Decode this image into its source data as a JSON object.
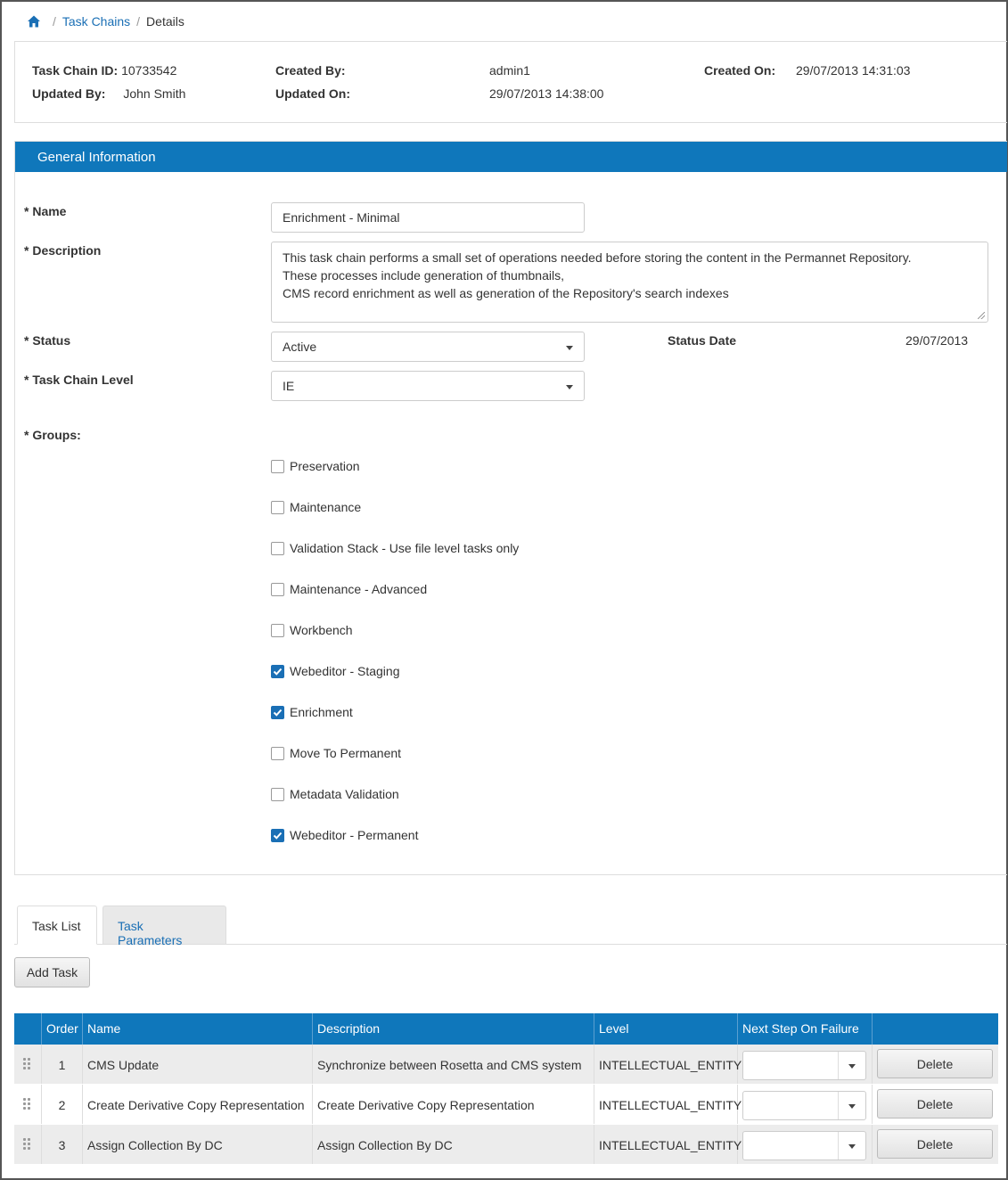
{
  "breadcrumb": {
    "home_icon": "home-icon",
    "link": "Task Chains",
    "current": "Details"
  },
  "header_info": {
    "task_chain_id_label": "Task Chain ID:",
    "task_chain_id": "10733542",
    "created_by_label": "Created By:",
    "created_by": "admin1",
    "created_on_label": "Created On:",
    "created_on": "29/07/2013 14:31:03",
    "updated_by_label": "Updated By:",
    "updated_by": "John Smith",
    "updated_on_label": "Updated On:",
    "updated_on": "29/07/2013 14:38:00"
  },
  "general": {
    "title": "General Information",
    "name_label": "* Name",
    "name_value": "Enrichment - Minimal",
    "description_label": "* Description",
    "description_lines": [
      "This task chain performs a small set of operations needed before storing the content in the Permannet Repository.",
      "These processes include generation of thumbnails,",
      "CMS record enrichment as well as generation of the Repository's search indexes"
    ],
    "status_label": "* Status",
    "status_value": "Active",
    "status_date_label": "Status Date",
    "status_date": "29/07/2013",
    "level_label": "* Task Chain Level",
    "level_value": "IE",
    "groups_label": "* Groups:",
    "groups": [
      {
        "label": "Preservation",
        "checked": false
      },
      {
        "label": "Maintenance",
        "checked": false
      },
      {
        "label": "Validation Stack - Use file level tasks only",
        "checked": false
      },
      {
        "label": "Maintenance - Advanced",
        "checked": false
      },
      {
        "label": "Workbench",
        "checked": false
      },
      {
        "label": "Webeditor - Staging",
        "checked": true
      },
      {
        "label": "Enrichment",
        "checked": true
      },
      {
        "label": "Move To Permanent",
        "checked": false
      },
      {
        "label": "Metadata Validation",
        "checked": false
      },
      {
        "label": "Webeditor - Permanent",
        "checked": true
      }
    ]
  },
  "tabs": {
    "task_list": "Task List",
    "task_parameters": "Task Parameters",
    "active": "Task List"
  },
  "add_task_label": "Add Task",
  "task_table": {
    "headers": [
      "",
      "Order",
      "Name",
      "Description",
      "Level",
      "Next Step On Failure",
      ""
    ],
    "rows": [
      {
        "order": "1",
        "name": "CMS Update",
        "description": "Synchronize between Rosetta and CMS system",
        "level": "INTELLECTUAL_ENTITY",
        "next_step": "",
        "delete": "Delete"
      },
      {
        "order": "2",
        "name": "Create Derivative Copy Representation",
        "description": "Create Derivative Copy Representation",
        "level": "INTELLECTUAL_ENTITY",
        "next_step": "",
        "delete": "Delete"
      },
      {
        "order": "3",
        "name": "Assign Collection By DC",
        "description": "Assign Collection By DC",
        "level": "INTELLECTUAL_ENTITY",
        "next_step": "",
        "delete": "Delete"
      }
    ]
  },
  "colors": {
    "primary": "#0f77bb",
    "link": "#1a6fb5"
  }
}
